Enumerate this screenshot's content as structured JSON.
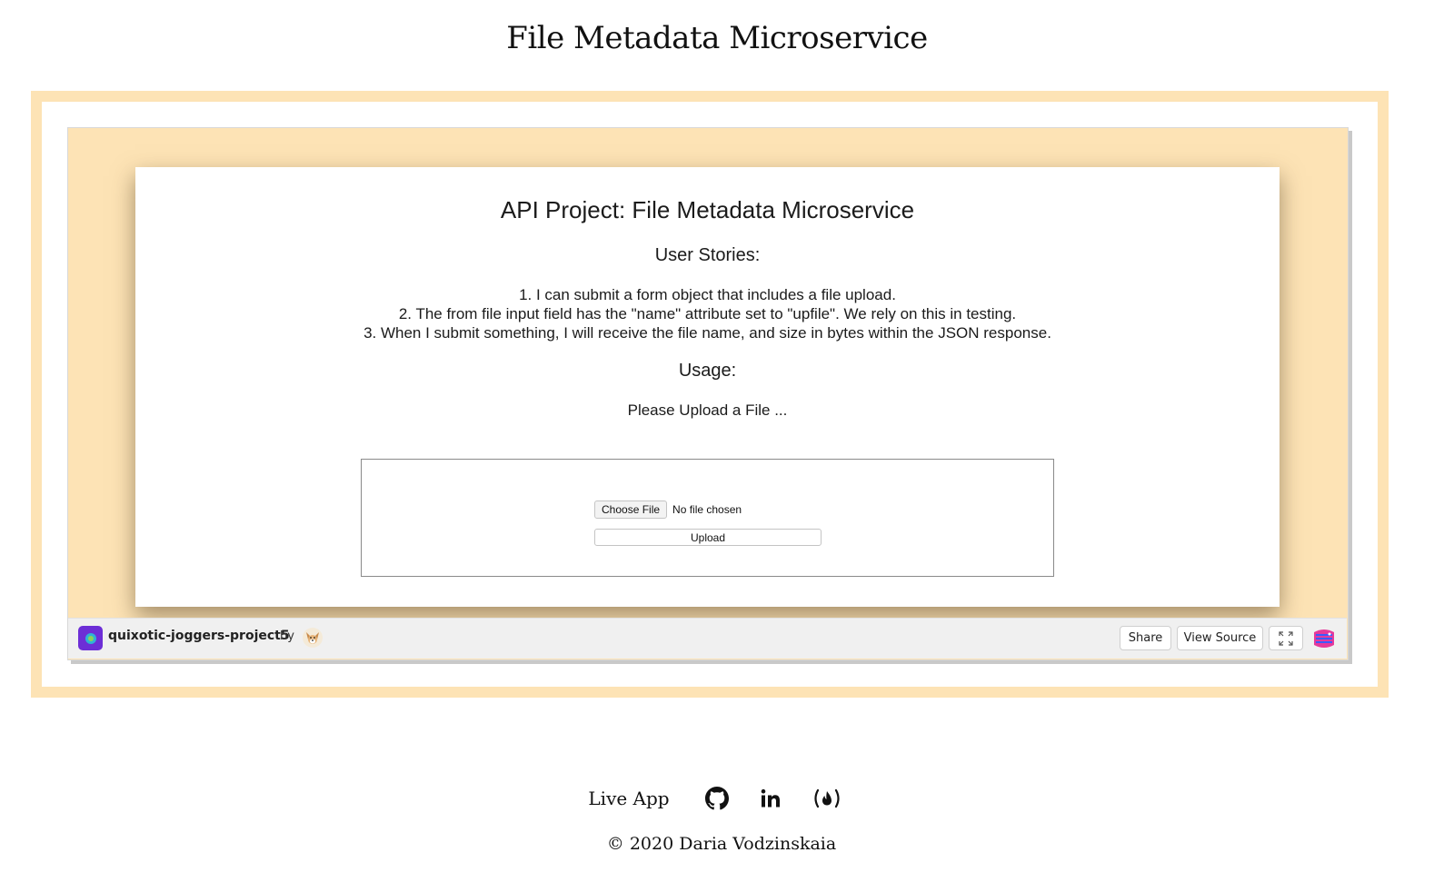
{
  "page": {
    "title": "File Metadata Microservice"
  },
  "app": {
    "title": "API Project: File Metadata Microservice",
    "stories_heading": "User Stories:",
    "stories": [
      "1. I can submit a form object that includes a file upload.",
      "2. The from file input field has the \"name\" attribute set to \"upfile\". We rely on this in testing.",
      "3. When I submit something, I will receive the file name, and size in bytes within the JSON response."
    ],
    "usage_heading": "Usage:",
    "upload_prompt": "Please Upload a File ...",
    "form": {
      "choose_label": "Choose File",
      "file_status": "No file chosen",
      "upload_label": "Upload"
    }
  },
  "glitch_bar": {
    "project_name": "quixotic-joggers-project5",
    "by_label": "by",
    "share_label": "Share",
    "view_source_label": "View Source",
    "icons": [
      "project-avatar-icon",
      "user-avatar-icon",
      "fullscreen-icon",
      "glitch-logo-icon"
    ]
  },
  "footer": {
    "live_app_label": "Live App",
    "icons": [
      "github-icon",
      "linkedin-icon",
      "freecodecamp-icon"
    ],
    "copyright": "© 2020 Daria Vodzinskaia"
  },
  "colors": {
    "frame": "#fde3b5",
    "project_avatar": "#6d2ed6",
    "glitch_logo": "#e6399b"
  }
}
